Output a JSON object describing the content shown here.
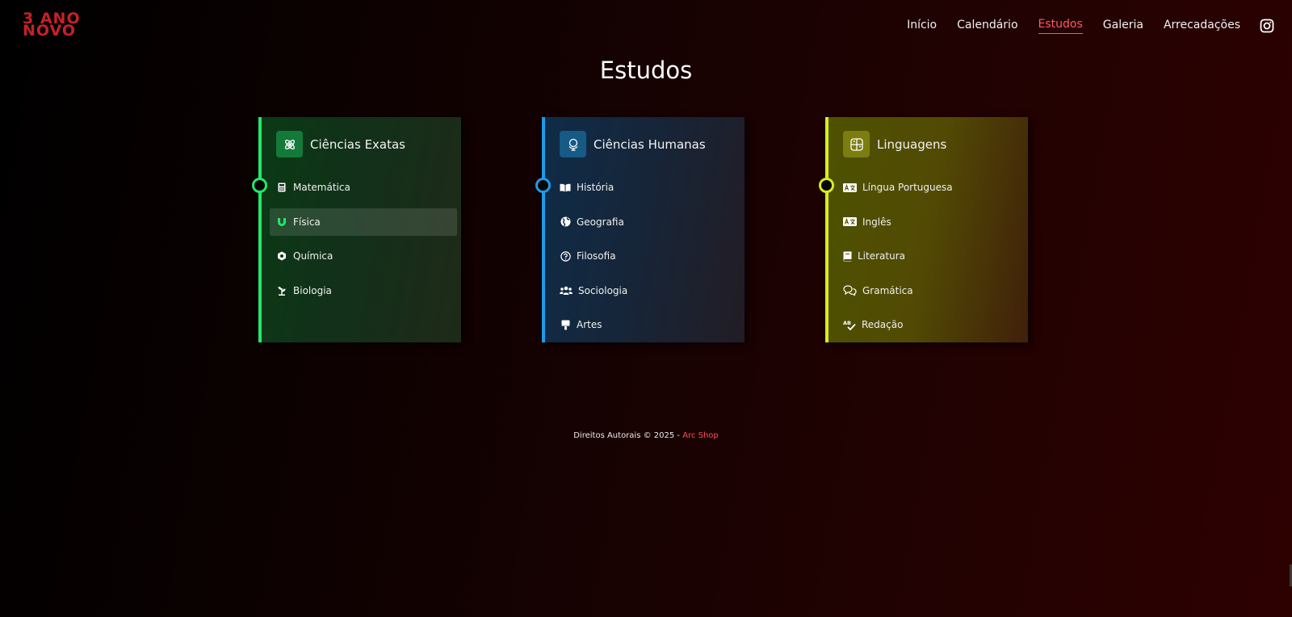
{
  "logo": {
    "line1": "3 ANO",
    "line2": "NOVO"
  },
  "nav": {
    "items": [
      {
        "label": "Início",
        "active": false
      },
      {
        "label": "Calendário",
        "active": false
      },
      {
        "label": "Estudos",
        "active": true
      },
      {
        "label": "Galeria",
        "active": false
      },
      {
        "label": "Arrecadações",
        "active": false
      }
    ],
    "instagram_icon": "instagram-icon"
  },
  "page": {
    "title": "Estudos"
  },
  "cards": [
    {
      "title": "Ciências Exatas",
      "accent": "#20e86a",
      "icon_bg": "#137a3a",
      "icon": "atom-icon",
      "items": [
        {
          "label": "Matemática",
          "icon": "calculator-icon"
        },
        {
          "label": "Física",
          "icon": "magnet-icon"
        },
        {
          "label": "Química",
          "icon": "hexagon-nut-icon"
        },
        {
          "label": "Biologia",
          "icon": "seedling-icon"
        }
      ]
    },
    {
      "title": "Ciências Humanas",
      "accent": "#1e9ae8",
      "icon_bg": "#175a85",
      "icon": "globe-stand-icon",
      "items": [
        {
          "label": "História",
          "icon": "open-book-icon"
        },
        {
          "label": "Geografia",
          "icon": "earth-icon"
        },
        {
          "label": "Filosofia",
          "icon": "question-circle-icon"
        },
        {
          "label": "Sociologia",
          "icon": "people-group-icon"
        },
        {
          "label": "Artes",
          "icon": "paint-brush-icon"
        }
      ]
    },
    {
      "title": "Linguagens",
      "accent": "#d8ee1c",
      "icon_bg": "#7b7d10",
      "icon": "language-icon",
      "items": [
        {
          "label": "Língua Portuguesa",
          "icon": "language-card-icon"
        },
        {
          "label": "Inglês",
          "icon": "language-card-icon"
        },
        {
          "label": "Literatura",
          "icon": "book-icon"
        },
        {
          "label": "Gramática",
          "icon": "comments-icon"
        },
        {
          "label": "Redação",
          "icon": "spell-check-icon"
        }
      ]
    }
  ],
  "footer": {
    "text": "Direitos Autorais © 2025 - ",
    "brand": "Arc Shop"
  }
}
